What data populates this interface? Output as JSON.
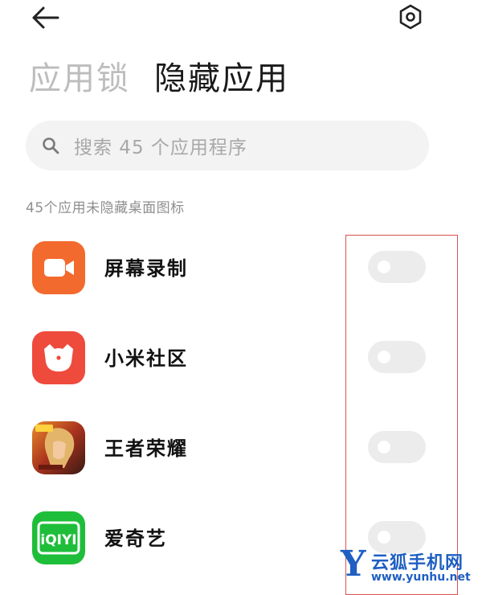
{
  "header": {
    "back_icon": "arrow-left-icon",
    "settings_icon": "hexagon-gear-icon"
  },
  "tabs": [
    {
      "label": "应用锁",
      "active": false
    },
    {
      "label": "隐藏应用",
      "active": true
    }
  ],
  "search": {
    "placeholder": "搜索 45 个应用程序",
    "icon": "search-icon"
  },
  "section": {
    "label": "45个应用未隐藏桌面图标"
  },
  "apps": [
    {
      "name": "屏幕录制",
      "icon": "screen-recorder-icon",
      "hidden": false
    },
    {
      "name": "小米社区",
      "icon": "xiaomi-community-icon",
      "hidden": false
    },
    {
      "name": "王者荣耀",
      "icon": "honor-of-kings-icon",
      "hidden": false
    },
    {
      "name": "爱奇艺",
      "icon": "iqiyi-icon",
      "hidden": false
    }
  ],
  "colors": {
    "toggle_off": "#ececec",
    "highlight": "#d9534f",
    "screen_recorder": "#f26a2e",
    "xiaomi_community": "#ee4b3d",
    "iqiyi": "#1fbe3a"
  },
  "watermark": {
    "letter": "Y",
    "title": "云狐手机网",
    "url": "www.yunhu.net"
  }
}
